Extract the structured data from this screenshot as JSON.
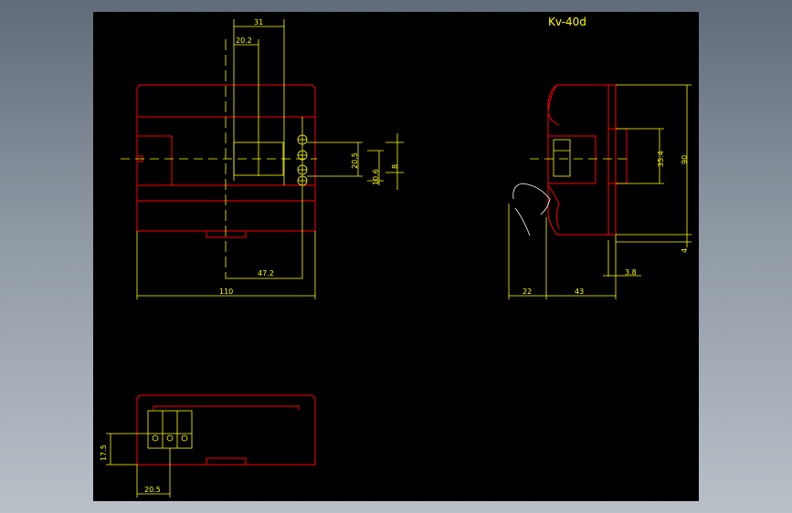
{
  "viewport": {
    "background": "#8a95a1",
    "canvas": "#000000"
  },
  "colors": {
    "outline": "#ff0000",
    "dimension": "#ffff00",
    "title": "#ffff00"
  },
  "title": "Kv-40d",
  "front_view": {
    "dims": {
      "top_overall": "31",
      "top_inner": "20.2",
      "height_a": "20.5",
      "height_b": "10.6",
      "height_c": "8",
      "bottom_offset": "47.2",
      "width": "110"
    }
  },
  "side_view": {
    "dims": {
      "inner_height": "35.4",
      "overall_height": "90",
      "foot": "4",
      "depth_left": "22",
      "depth_right": "43",
      "rail_offset": "3.8"
    }
  },
  "bottom_view": {
    "dims": {
      "height": "17.5",
      "terminal_width": "20.5"
    }
  }
}
